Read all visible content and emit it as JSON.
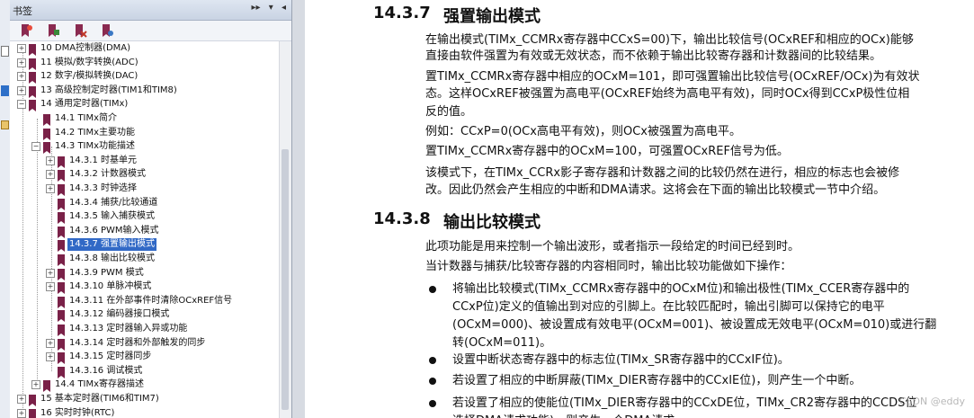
{
  "bookmark_panel": {
    "title": "书签",
    "controls": [
      "▸▸",
      "▾",
      "◂"
    ]
  },
  "tree": {
    "items": [
      {
        "label": "10 DMA控制器(DMA)",
        "level": 0,
        "toggle": "+"
      },
      {
        "label": "11 模拟/数字转换(ADC)",
        "level": 0,
        "toggle": "+"
      },
      {
        "label": "12 数字/模拟转换(DAC)",
        "level": 0,
        "toggle": "+"
      },
      {
        "label": "13 高级控制定时器(TIM1和TIM8)",
        "level": 0,
        "toggle": "+"
      },
      {
        "label": "14 通用定时器(TIMx)",
        "level": 0,
        "toggle": "−"
      },
      {
        "label": "14.1 TIMx简介",
        "level": 1,
        "toggle": ""
      },
      {
        "label": "14.2 TIMx主要功能",
        "level": 1,
        "toggle": ""
      },
      {
        "label": "14.3 TIMx功能描述",
        "level": 1,
        "toggle": "−"
      },
      {
        "label": "14.3.1 时基单元",
        "level": 2,
        "toggle": "+"
      },
      {
        "label": "14.3.2 计数器模式",
        "level": 2,
        "toggle": "+"
      },
      {
        "label": "14.3.3 时钟选择",
        "level": 2,
        "toggle": "+"
      },
      {
        "label": "14.3.4 捕获/比较通道",
        "level": 2,
        "toggle": ""
      },
      {
        "label": "14.3.5 输入捕获模式",
        "level": 2,
        "toggle": ""
      },
      {
        "label": "14.3.6 PWM输入模式",
        "level": 2,
        "toggle": ""
      },
      {
        "label": "14.3.7 强置输出模式",
        "level": 2,
        "toggle": "",
        "selected": true
      },
      {
        "label": "14.3.8 输出比较模式",
        "level": 2,
        "toggle": ""
      },
      {
        "label": "14.3.9 PWM 模式",
        "level": 2,
        "toggle": "+"
      },
      {
        "label": "14.3.10 单脉冲模式",
        "level": 2,
        "toggle": "+"
      },
      {
        "label": "14.3.11 在外部事件时清除OCxREF信号",
        "level": 2,
        "toggle": ""
      },
      {
        "label": "14.3.12 编码器接口模式",
        "level": 2,
        "toggle": ""
      },
      {
        "label": "14.3.13 定时器输入异或功能",
        "level": 2,
        "toggle": ""
      },
      {
        "label": "14.3.14 定时器和外部触发的同步",
        "level": 2,
        "toggle": "+"
      },
      {
        "label": "14.3.15 定时器同步",
        "level": 2,
        "toggle": "+"
      },
      {
        "label": "14.3.16 调试模式",
        "level": 2,
        "toggle": ""
      },
      {
        "label": "14.4 TIMx寄存器描述",
        "level": 1,
        "toggle": "+"
      },
      {
        "label": "15 基本定时器(TIM6和TIM7)",
        "level": 0,
        "toggle": "+"
      },
      {
        "label": "16 实时时钟(RTC)",
        "level": 0,
        "toggle": "+"
      }
    ]
  },
  "doc": {
    "sec1_num": "14.3.7",
    "sec1_title": "强置输出模式",
    "sec1_lines": [
      "在输出模式(TIMx_CCMRx寄存器中CCxS=00)下，输出比较信号(OCxREF和相应的OCx)能够",
      "直接由软件强置为有效或无效状态，而不依赖于输出比较寄存器和计数器间的比较结果。",
      "置TIMx_CCMRx寄存器中相应的OCxM=101，即可强置输出比较信号(OCxREF/OCx)为有效状",
      "态。这样OCxREF被强置为高电平(OCxREF始终为高电平有效)，同时OCx得到CCxP极性位相",
      "反的值。",
      "例如：CCxP=0(OCx高电平有效)，则OCx被强置为高电平。",
      "置TIMx_CCMRx寄存器中的OCxM=100，可强置OCxREF信号为低。",
      "该模式下，在TIMx_CCRx影子寄存器和计数器之间的比较仍然在进行，相应的标志也会被修",
      "改。因此仍然会产生相应的中断和DMA请求。这将会在下面的输出比较模式一节中介绍。"
    ],
    "sec2_num": "14.3.8",
    "sec2_title": "输出比较模式",
    "sec2_lines": [
      "此项功能是用来控制一个输出波形，或者指示一段给定的时间已经到时。",
      "当计数器与捕获/比较寄存器的内容相同时，输出比较功能做如下操作："
    ],
    "bullets": [
      [
        "将输出比较模式(TIMx_CCMRx寄存器中的OCxM位)和输出极性(TIMx_CCER寄存器中的",
        "CCxP位)定义的值输出到对应的引脚上。在比较匹配时，输出引脚可以保持它的电平",
        "(OCxM=000)、被设置成有效电平(OCxM=001)、被设置成无效电平(OCxM=010)或进行翻",
        "转(OCxM=011)。"
      ],
      [
        "设置中断状态寄存器中的标志位(TIMx_SR寄存器中的CCxIF位)。"
      ],
      [
        "若设置了相应的中断屏蔽(TIMx_DIER寄存器中的CCxIE位)，则产生一个中断。"
      ],
      [
        "若设置了相应的使能位(TIMx_DIER寄存器中的CCxDE位，TIMx_CR2寄存器中的CCDS位",
        "选择DMA请求功能)，则产生一个DMA请求。"
      ]
    ],
    "watermark": "CSDN @eddy"
  },
  "colors": {
    "selection": "#3169c6",
    "bookmark_icon": "#7a2148",
    "header_bg": "#c9d3e3"
  }
}
